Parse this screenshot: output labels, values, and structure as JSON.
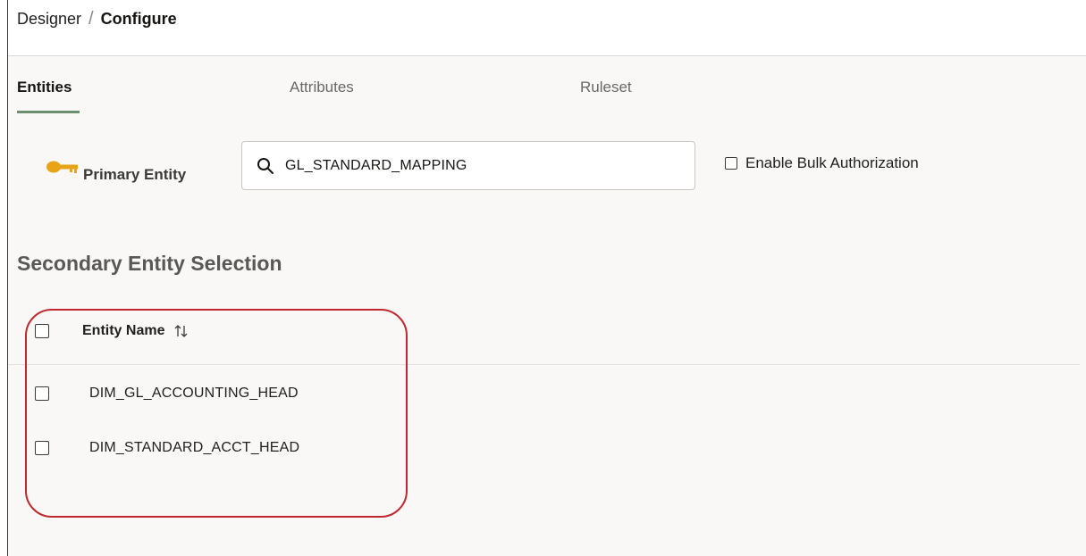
{
  "breadcrumb": {
    "parent": "Designer",
    "separator": "/",
    "current": "Configure"
  },
  "tabs": [
    {
      "label": "Entities",
      "active": true
    },
    {
      "label": "Attributes",
      "active": false
    },
    {
      "label": "Ruleset",
      "active": false
    }
  ],
  "primary_entity": {
    "label": "Primary Entity",
    "icon": "key-icon",
    "search_icon": "search-icon",
    "value": "GL_STANDARD_MAPPING"
  },
  "bulk_authorization": {
    "label": "Enable Bulk Authorization",
    "checked": false
  },
  "secondary": {
    "title": "Secondary Entity Selection",
    "column_header": "Entity Name",
    "sort_icon": "sort-icon",
    "rows": [
      {
        "name": "DIM_GL_ACCOUNTING_HEAD",
        "checked": false
      },
      {
        "name": "DIM_STANDARD_ACCT_HEAD",
        "checked": false
      }
    ]
  },
  "colors": {
    "active_tab_underline": "#6b8f6f",
    "key_icon": "#e8a317",
    "highlight_border": "#c0282d"
  }
}
